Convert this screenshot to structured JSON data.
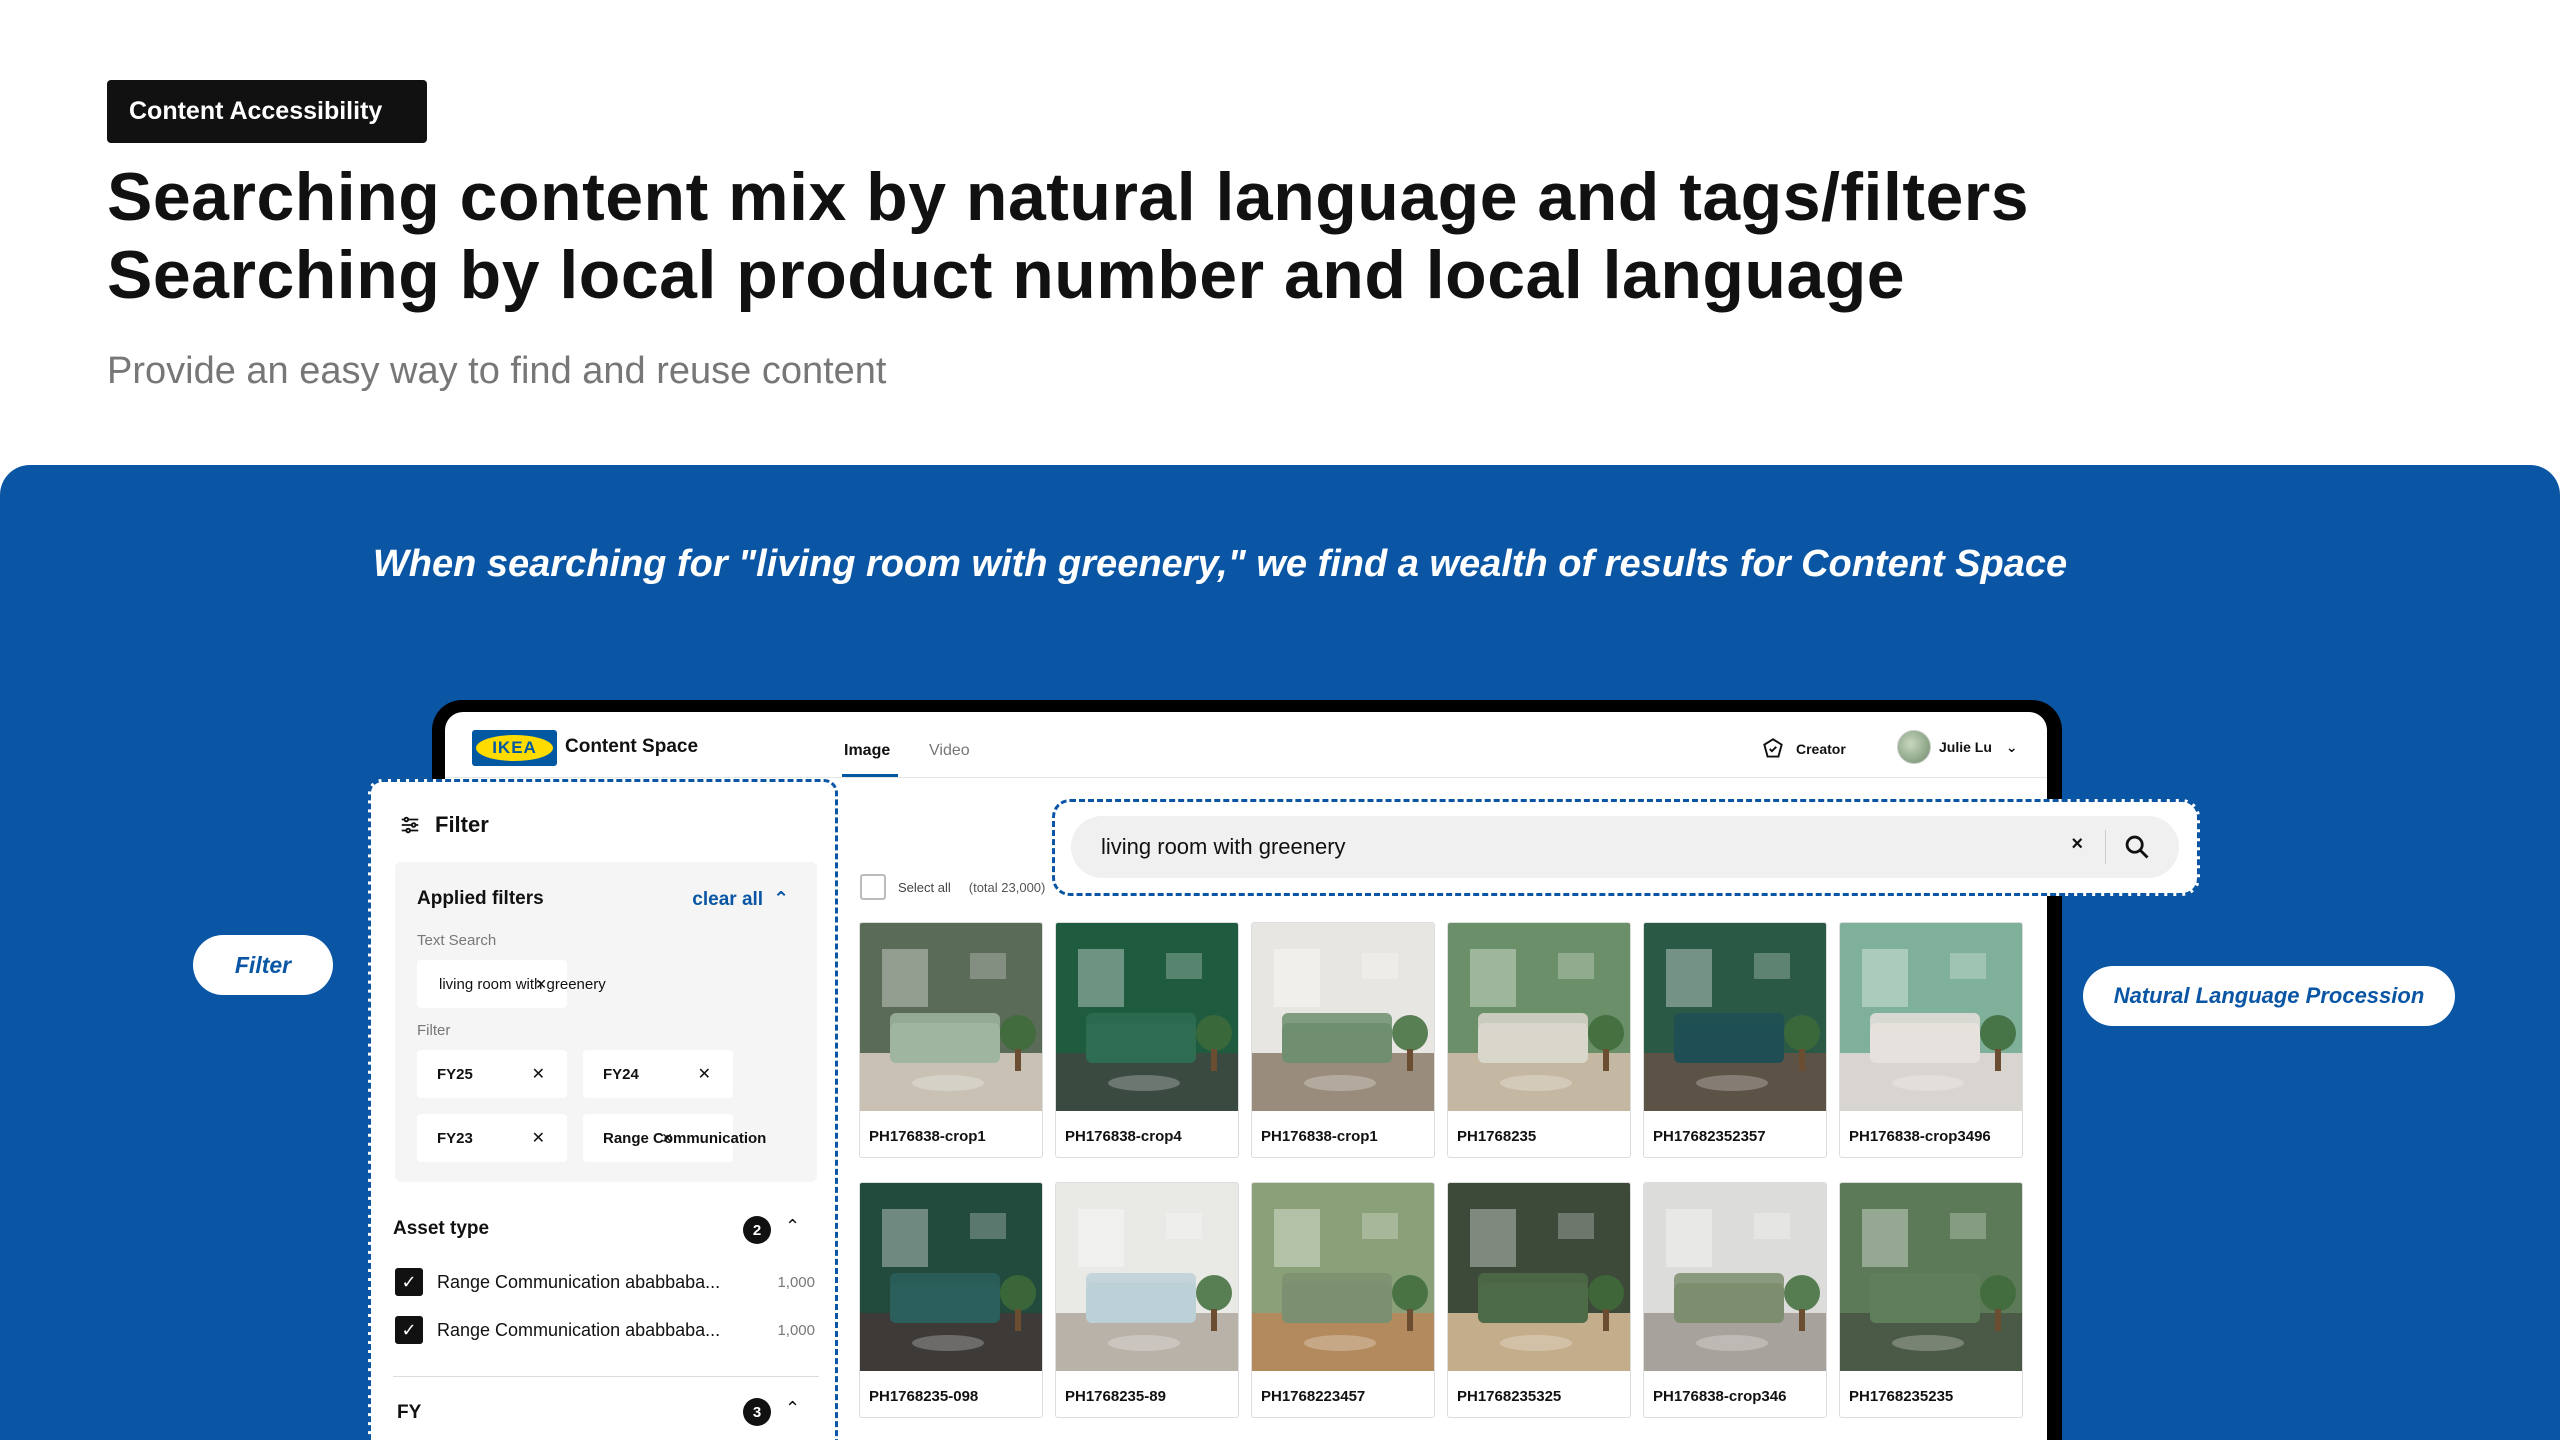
{
  "header": {
    "badge": "Content Accessibility",
    "title_line1": "Searching content mix by natural language and tags/filters",
    "title_line2": "Searching by local product number and local language",
    "subtitle": "Provide an easy way to find and reuse content"
  },
  "banner": {
    "tagline": "When searching for \"living room with greenery,\" we find a wealth of results for Content Space",
    "filter_callout": "Filter",
    "nlp_callout": "Natural Language Procession"
  },
  "app": {
    "logo": "IKEA",
    "name": "Content Space",
    "tabs": [
      {
        "label": "Image"
      },
      {
        "label": "Video"
      }
    ],
    "creator_label": "Creator",
    "user_name": "Julie Lu"
  },
  "search": {
    "value": "living room with greenery",
    "clear_symbol": "×"
  },
  "results": {
    "select_all": "Select all",
    "total": "(total 23,000)",
    "items": [
      {
        "label": "PH176838-crop1",
        "wall": "#5a6b57",
        "sofa": "#9fb5a0",
        "floor": "#c9c2b4"
      },
      {
        "label": "PH176838-crop4",
        "wall": "#1f5b3f",
        "sofa": "#2f6d52",
        "floor": "#3a4a40"
      },
      {
        "label": "PH176838-crop1",
        "wall": "#e8e6e2",
        "sofa": "#6f8f70",
        "floor": "#9a8c7c"
      },
      {
        "label": "PH1768235",
        "wall": "#6b8f68",
        "sofa": "#d9d6cc",
        "floor": "#c5b8a3"
      },
      {
        "label": "PH17682352357",
        "wall": "#2a5a45",
        "sofa": "#1f4f55",
        "floor": "#5c5246"
      },
      {
        "label": "PH176838-crop3496",
        "wall": "#7fb09a",
        "sofa": "#e6e1dc",
        "floor": "#d8d4cf"
      },
      {
        "label": "PH1768235-098",
        "wall": "#234b3d",
        "sofa": "#2a5f5c",
        "floor": "#3d3a37"
      },
      {
        "label": "PH1768235-89",
        "wall": "#e9e9e6",
        "sofa": "#bcd0d8",
        "floor": "#b8b2a9"
      },
      {
        "label": "PH1768223457",
        "wall": "#8aa078",
        "sofa": "#7a9070",
        "floor": "#b38a5e"
      },
      {
        "label": "PH1768235325",
        "wall": "#3d4a3a",
        "sofa": "#4c6b46",
        "floor": "#c4ad8a"
      },
      {
        "label": "PH176838-crop346",
        "wall": "#dcdcda",
        "sofa": "#7d8e6e",
        "floor": "#a7a39c"
      },
      {
        "label": "PH1768235235",
        "wall": "#5c7a58",
        "sofa": "#5f7f5a",
        "floor": "#4b5a46"
      }
    ]
  },
  "filter": {
    "title": "Filter",
    "applied": "Applied filters",
    "clear_all": "clear all",
    "text_search_label": "Text Search",
    "text_search_value": "living room with greenery",
    "filter_label": "Filter",
    "chips": [
      {
        "label": "FY25"
      },
      {
        "label": "FY24"
      },
      {
        "label": "FY23"
      },
      {
        "label": "Range Communication"
      }
    ],
    "asset_type": {
      "title": "Asset type",
      "count": "2",
      "options": [
        {
          "label": "Range Communication ababbaba...",
          "count": "1,000"
        },
        {
          "label": "Range Communication ababbaba...",
          "count": "1,000"
        }
      ]
    },
    "fy": {
      "title": "FY",
      "count": "3"
    }
  },
  "colors": {
    "brand_blue": "#0a56a5",
    "ikea_blue": "#0058a3",
    "ikea_yellow": "#ffdb00"
  }
}
